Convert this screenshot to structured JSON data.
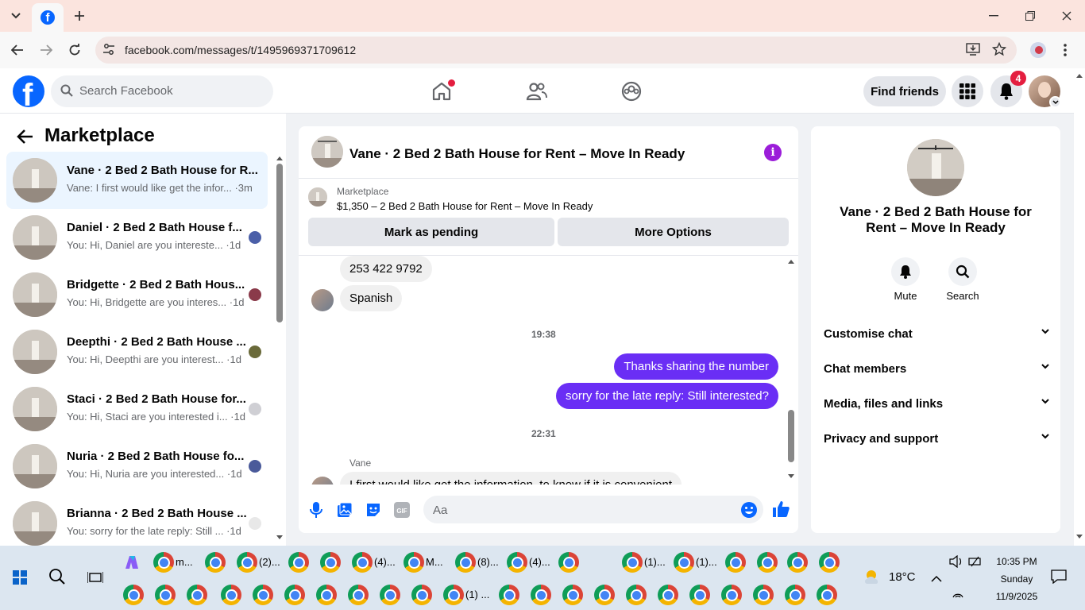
{
  "browser": {
    "url": "facebook.com/messages/t/1495969371709612"
  },
  "header": {
    "search_placeholder": "Search Facebook",
    "find_friends_label": "Find friends",
    "notifications_count": "4"
  },
  "left_panel": {
    "title": "Marketplace",
    "conversations": [
      {
        "title": "Vane · 2 Bed 2 Bath House for R...",
        "preview": "Vane: I first would like get the infor... ·3m"
      },
      {
        "title": "Daniel · 2 Bed 2 Bath House f...",
        "preview": "You: Hi, Daniel are you intereste... ·1d"
      },
      {
        "title": "Bridgette · 2 Bed 2 Bath Hous...",
        "preview": "You: Hi, Bridgette are you interes... ·1d"
      },
      {
        "title": "Deepthi · 2 Bed 2 Bath House ...",
        "preview": "You: Hi, Deepthi are you interest... ·1d"
      },
      {
        "title": "Staci · 2 Bed 2 Bath House for...",
        "preview": "You: Hi, Staci are you interested i... ·1d"
      },
      {
        "title": "Nuria · 2 Bed 2 Bath House fo...",
        "preview": "You: Hi, Nuria are you interested... ·1d"
      },
      {
        "title": "Brianna · 2 Bed 2 Bath House ...",
        "preview": "You: sorry for the late reply: Still ... ·1d"
      }
    ]
  },
  "chat": {
    "title": "Vane · 2 Bed 2 Bath House for Rent – Move In Ready",
    "marketplace_label": "Marketplace",
    "listing": "$1,350 – 2 Bed 2 Bath House for Rent – Move In Ready",
    "mark_pending_label": "Mark as pending",
    "more_options_label": "More Options",
    "messages": {
      "m1": "253 422 9792",
      "m2": "Spanish",
      "ts1": "19:38",
      "m3": "Thanks sharing the number",
      "m4": "sorry for the late reply: Still interested?",
      "ts2": "22:31",
      "sender": "Vane",
      "m5": "I first would like get the information, to know if it is convenient"
    },
    "input_placeholder": "Aa"
  },
  "right_panel": {
    "name": "Vane · 2 Bed 2 Bath House for Rent – Move In Ready",
    "mute_label": "Mute",
    "search_label": "Search",
    "sections": [
      "Customise chat",
      "Chat members",
      "Media, files and links",
      "Privacy and support"
    ]
  },
  "taskbar": {
    "labels_row1": [
      "m...",
      "(2)...",
      "(4)...",
      "M...",
      "(8)...",
      "(4)...",
      "(1)...",
      "(1)..."
    ],
    "labels_row2": [
      "(1) ..."
    ],
    "weather": "18°C",
    "time": "10:35 PM",
    "day": "Sunday",
    "date": "11/9/2025"
  },
  "colors": {
    "fb_blue": "#0866ff",
    "outgoing_bubble": "#6a2ef5",
    "badge_red": "#e41e3f",
    "active_convo": "#ebf5ff"
  }
}
